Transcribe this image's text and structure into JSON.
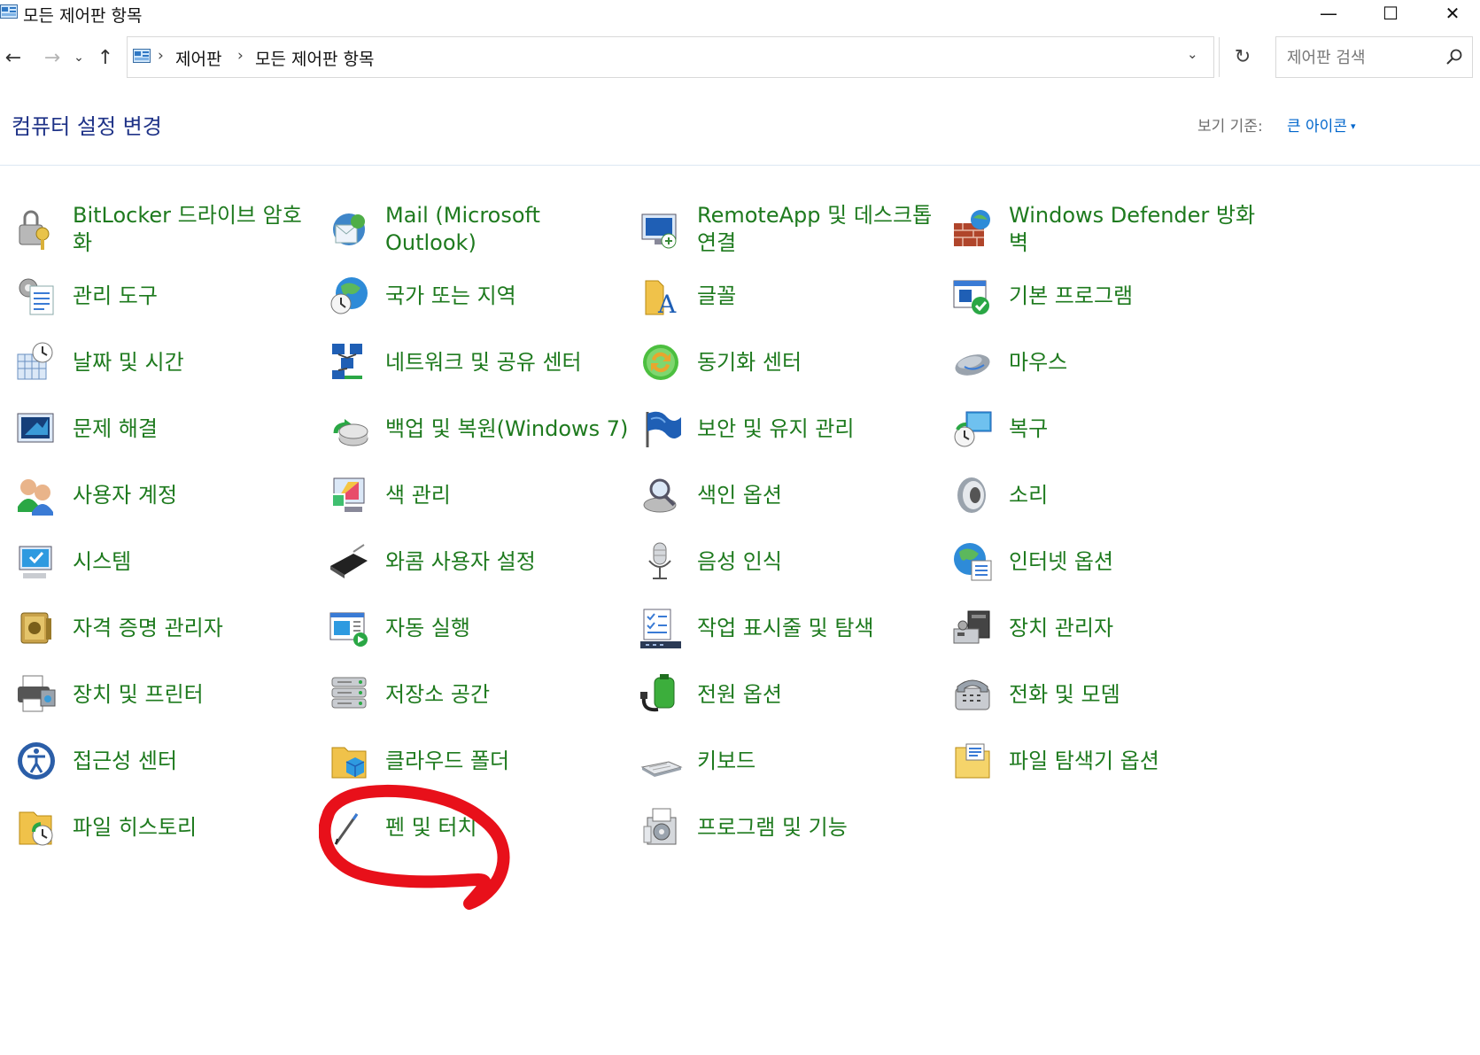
{
  "window": {
    "title": "모든 제어판 항목",
    "controls": {
      "minimize": "—",
      "maximize": "☐",
      "close": "✕"
    }
  },
  "nav": {
    "back": "←",
    "forward": "→",
    "recent": "⌄",
    "up": "↑",
    "breadcrumb": [
      "제어판",
      "모든 제어판 항목"
    ],
    "separator": "›",
    "dropdown": "⌄",
    "refresh": "↻"
  },
  "search": {
    "placeholder": "제어판 검색",
    "value": ""
  },
  "header": {
    "title": "컴퓨터 설정 변경",
    "view_by_label": "보기 기준:",
    "view_by_value": "큰 아이콘",
    "view_by_caret": "▾"
  },
  "items": [
    {
      "label": "BitLocker 드라이브 암호화",
      "icon": "bitlocker-icon"
    },
    {
      "label": "Mail (Microsoft Outlook)",
      "icon": "mail-icon"
    },
    {
      "label": "RemoteApp 및 데스크톱 연결",
      "icon": "remoteapp-icon"
    },
    {
      "label": "Windows Defender 방화벽",
      "icon": "firewall-icon"
    },
    {
      "label": "관리 도구",
      "icon": "admin-tools-icon"
    },
    {
      "label": "국가 또는 지역",
      "icon": "region-icon"
    },
    {
      "label": "글꼴",
      "icon": "fonts-icon"
    },
    {
      "label": "기본 프로그램",
      "icon": "default-programs-icon"
    },
    {
      "label": "날짜 및 시간",
      "icon": "date-time-icon"
    },
    {
      "label": "네트워크 및 공유 센터",
      "icon": "network-icon"
    },
    {
      "label": "동기화 센터",
      "icon": "sync-center-icon"
    },
    {
      "label": "마우스",
      "icon": "mouse-icon"
    },
    {
      "label": "문제 해결",
      "icon": "troubleshooting-icon"
    },
    {
      "label": "백업 및 복원(Windows 7)",
      "icon": "backup-icon"
    },
    {
      "label": "보안 및 유지 관리",
      "icon": "security-flag-icon"
    },
    {
      "label": "복구",
      "icon": "recovery-icon"
    },
    {
      "label": "사용자 계정",
      "icon": "user-accounts-icon"
    },
    {
      "label": "색 관리",
      "icon": "color-management-icon"
    },
    {
      "label": "색인 옵션",
      "icon": "indexing-icon"
    },
    {
      "label": "소리",
      "icon": "sound-icon"
    },
    {
      "label": "시스템",
      "icon": "system-icon"
    },
    {
      "label": "와콤 사용자 설정",
      "icon": "wacom-icon"
    },
    {
      "label": "음성 인식",
      "icon": "speech-icon"
    },
    {
      "label": "인터넷 옵션",
      "icon": "internet-options-icon"
    },
    {
      "label": "자격 증명 관리자",
      "icon": "credential-icon"
    },
    {
      "label": "자동 실행",
      "icon": "autoplay-icon"
    },
    {
      "label": "작업 표시줄 및 탐색",
      "icon": "taskbar-icon"
    },
    {
      "label": "장치 관리자",
      "icon": "device-manager-icon"
    },
    {
      "label": "장치 및 프린터",
      "icon": "printer-icon"
    },
    {
      "label": "저장소 공간",
      "icon": "storage-icon"
    },
    {
      "label": "전원 옵션",
      "icon": "power-icon"
    },
    {
      "label": "전화 및 모뎀",
      "icon": "phone-icon"
    },
    {
      "label": "접근성 센터",
      "icon": "ease-of-access-icon"
    },
    {
      "label": "클라우드 폴더",
      "icon": "cloud-folder-icon"
    },
    {
      "label": "키보드",
      "icon": "keyboard-icon"
    },
    {
      "label": "파일 탐색기 옵션",
      "icon": "folder-options-icon"
    },
    {
      "label": "파일 히스토리",
      "icon": "file-history-icon"
    },
    {
      "label": "펜 및 터치",
      "icon": "pen-icon"
    },
    {
      "label": "프로그램 및 기능",
      "icon": "programs-icon"
    }
  ],
  "colors": {
    "item_text": "#1e7a1e",
    "header_title": "#1e3287",
    "link": "#0066cc",
    "annotation": "#e8101a"
  }
}
